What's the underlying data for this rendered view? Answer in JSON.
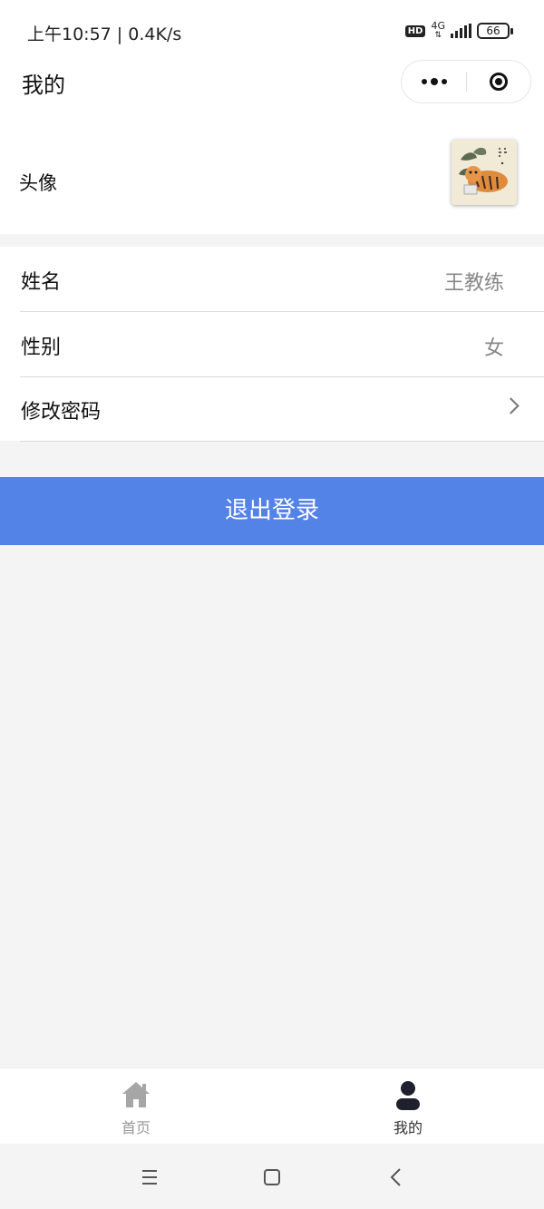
{
  "status_bar": {
    "time_speed": "上午10:57 | 0.4K/s",
    "hd_badge": "HD",
    "network": "4G",
    "battery": "66"
  },
  "nav": {
    "title": "我的"
  },
  "profile": {
    "avatar_label": "头像",
    "rows": [
      {
        "label": "姓名",
        "value": "王教练"
      },
      {
        "label": "性别",
        "value": "女"
      },
      {
        "label": "修改密码"
      }
    ]
  },
  "logout_label": "退出登录",
  "tabs": [
    {
      "label": "首页",
      "icon": "home-icon",
      "color": "#999999"
    },
    {
      "label": "我的",
      "icon": "user-icon",
      "color": "#222222"
    }
  ],
  "colors": {
    "accent": "#5483e8",
    "page_bg": "#f4f4f4"
  }
}
